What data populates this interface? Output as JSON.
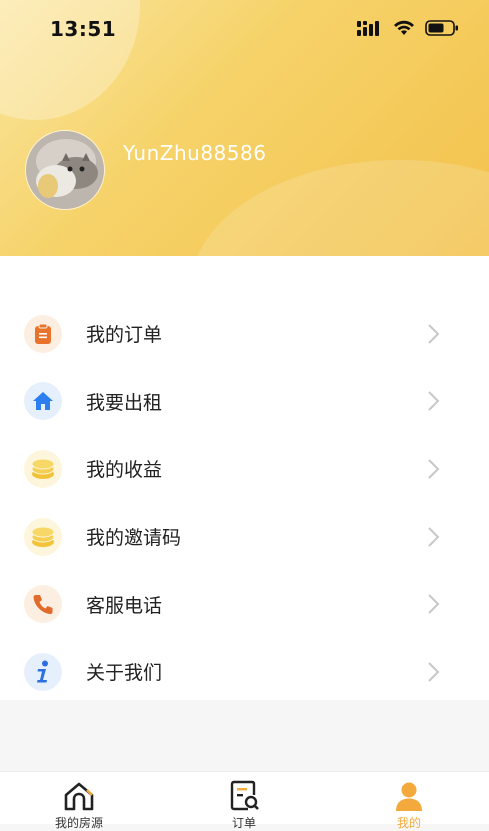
{
  "status_bar": {
    "time": "13:51"
  },
  "profile": {
    "username": "YunZhu88586"
  },
  "menu": {
    "items": [
      {
        "label": "我的订单",
        "icon": "clipboard-icon",
        "color": "#e8742b",
        "bg": "#fdeee2"
      },
      {
        "label": "我要出租",
        "icon": "home-icon",
        "color": "#2d7ff0",
        "bg": "#e6f0fd"
      },
      {
        "label": "我的收益",
        "icon": "coins-icon",
        "color": "#f2c238",
        "bg": "#fdf6dc"
      },
      {
        "label": "我的邀请码",
        "icon": "coins-icon",
        "color": "#f2c238",
        "bg": "#fdf6dc"
      },
      {
        "label": "客服电话",
        "icon": "phone-icon",
        "color": "#e06b2b",
        "bg": "#fdeee2"
      },
      {
        "label": "关于我们",
        "icon": "info-icon",
        "color": "#2d6fe0",
        "bg": "#e6f0fd"
      }
    ]
  },
  "tabbar": {
    "tabs": [
      {
        "label": "我的房源",
        "icon": "house-outline-icon"
      },
      {
        "label": "订单",
        "icon": "order-search-icon"
      },
      {
        "label": "我的",
        "icon": "person-icon",
        "active": true
      }
    ]
  },
  "colors": {
    "accent": "#f3a93b",
    "header_start": "#fbe6a0",
    "header_end": "#f3c14b"
  }
}
